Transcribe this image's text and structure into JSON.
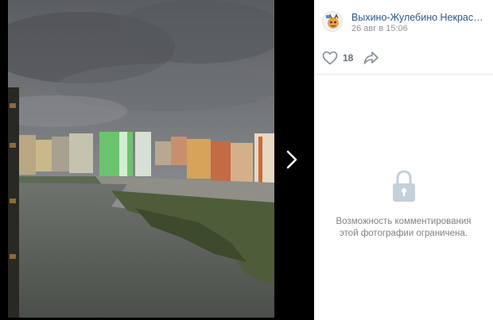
{
  "post": {
    "author": "Выхино-Жулебино Некрасовка Лю…",
    "date": "26 авг в 15:06"
  },
  "actions": {
    "like_count": "18",
    "like_icon": "heart-outline",
    "share_icon": "share-arrow"
  },
  "comments": {
    "closed_text": "Возможность комментирования этой фотографии ограничена.",
    "icon": "lock"
  },
  "viewer": {
    "next_icon": "chevron-right",
    "photo": "cityscape-river-overcast"
  },
  "colors": {
    "link": "#2a5885",
    "muted": "#939393",
    "panel_bg": "#ffffff",
    "viewer_bg": "#000000"
  }
}
